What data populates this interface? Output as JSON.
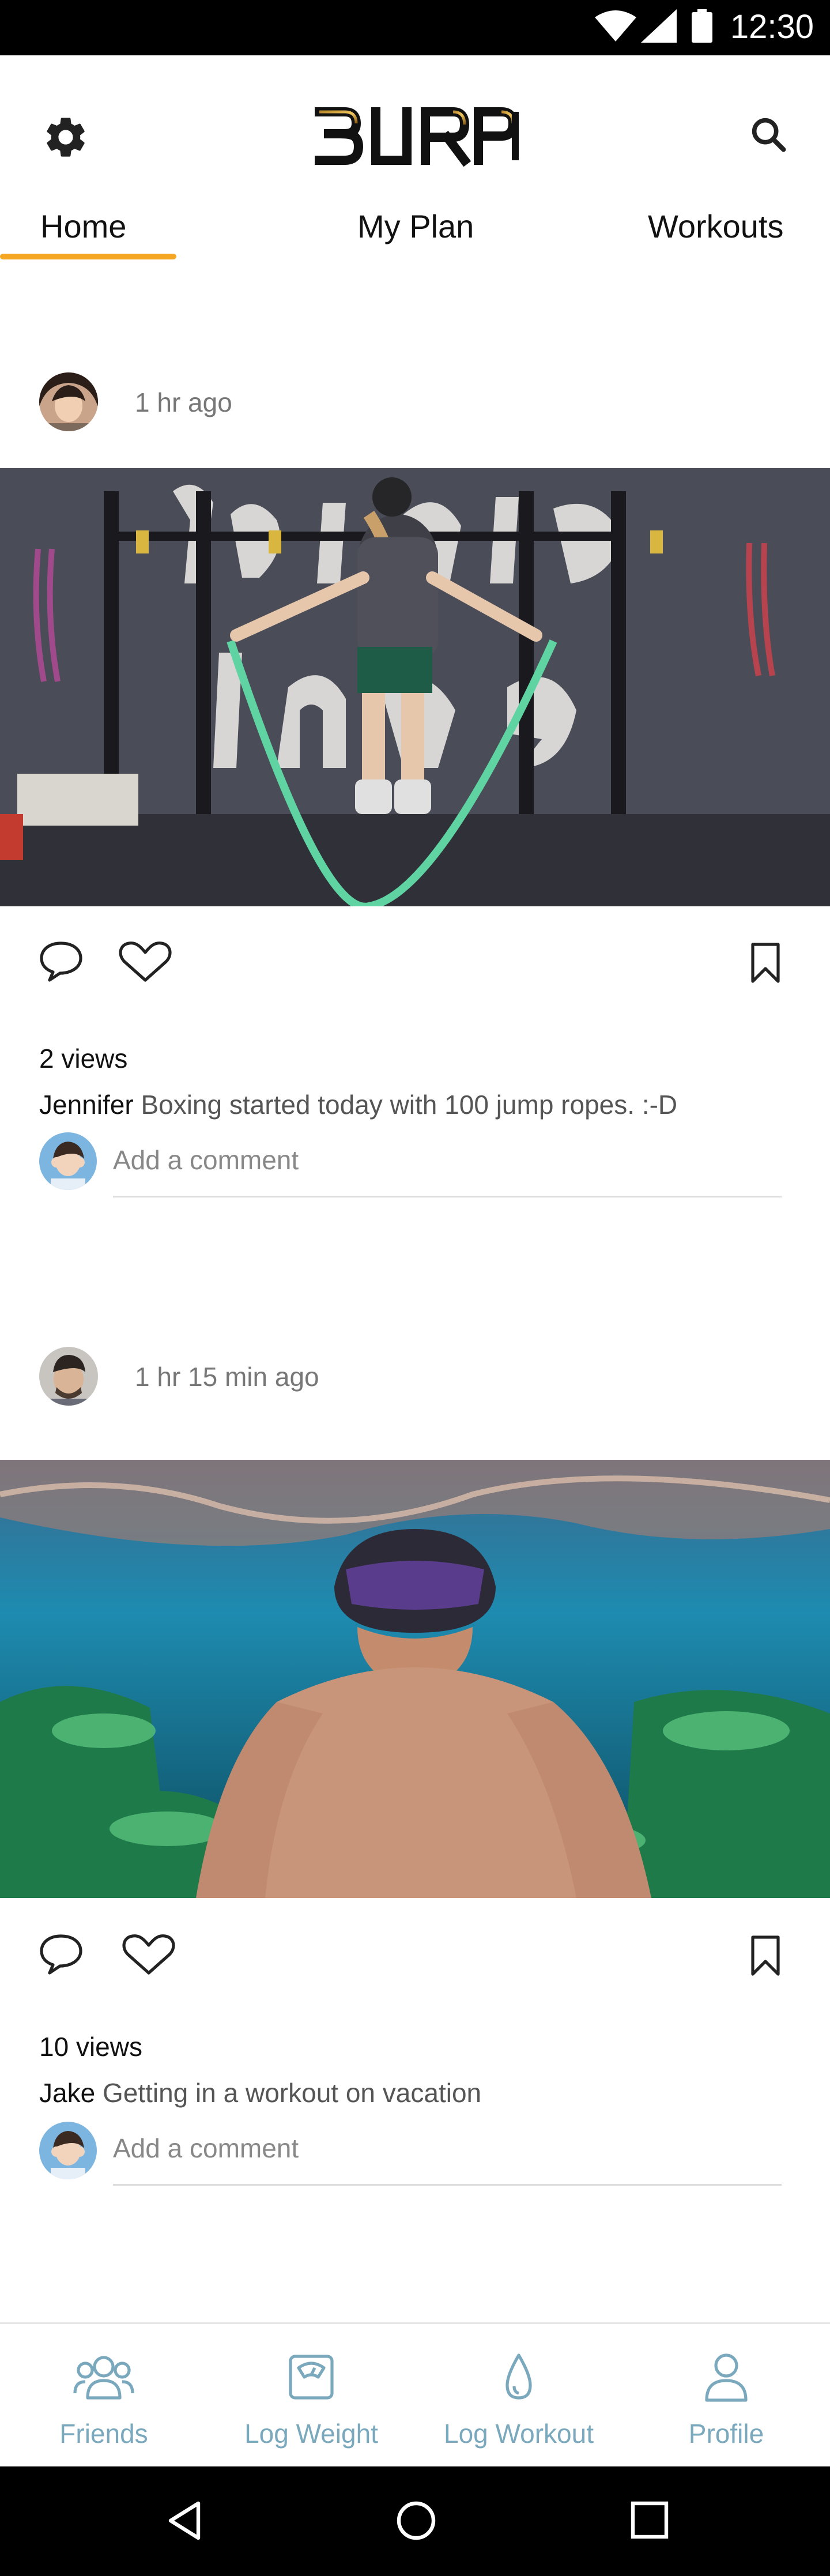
{
  "status_bar": {
    "time": "12:30",
    "icons": [
      "wifi-icon",
      "signal-icon",
      "battery-icon"
    ]
  },
  "app": {
    "logo_text": "BURPI",
    "tabs": [
      {
        "label": "Home",
        "active": true
      },
      {
        "label": "My Plan",
        "active": false
      },
      {
        "label": "Workouts",
        "active": false
      }
    ],
    "accent_color": "#f5a623"
  },
  "feed": {
    "posts": [
      {
        "time": "1 hr ago",
        "views": "2 views",
        "user": "Jennifer",
        "caption": "Boxing started today with 100 jump ropes. :-D",
        "comment_placeholder": "Add a comment",
        "photo": "jump-rope-gym-photo"
      },
      {
        "time": "1 hr 15 min ago",
        "views": "10 views",
        "user": "Jake",
        "caption": "Getting in a workout on vacation",
        "comment_placeholder": "Add a comment",
        "photo": "underwater-selfie-photo"
      }
    ]
  },
  "bottom_nav": {
    "items": [
      {
        "label": "Friends",
        "icon": "friends-icon"
      },
      {
        "label": "Log Weight",
        "icon": "scale-icon"
      },
      {
        "label": "Log Workout",
        "icon": "drop-icon"
      },
      {
        "label": "Profile",
        "icon": "person-icon"
      }
    ],
    "color": "#7aa8bd"
  },
  "system_nav": [
    "back-icon",
    "home-icon",
    "recents-icon"
  ]
}
